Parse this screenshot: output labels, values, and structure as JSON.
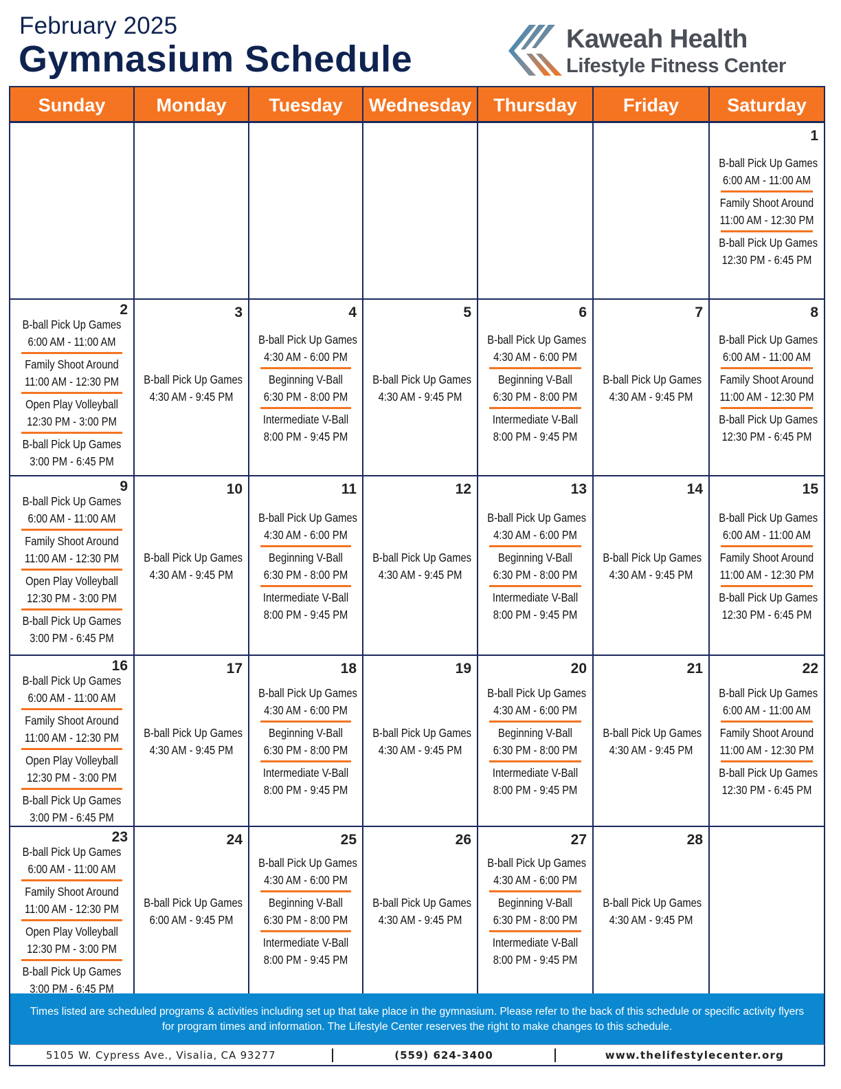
{
  "header": {
    "month": "February 2025",
    "title": "Gymnasium Schedule"
  },
  "logo": {
    "icon": "kaweah-health-k-logo-icon",
    "line1": "Kaweah Health",
    "line2": "Lifestyle Fitness Center",
    "colors": {
      "blue": "#1e88c9",
      "gray": "#6d6f73",
      "orange": "#f47421",
      "text": "#4a4f57"
    }
  },
  "colors": {
    "accent": "#f47421",
    "navy": "#1b2a5c",
    "notice_bg": "#0b88cf",
    "title": "#0f2350"
  },
  "days_of_week": [
    "Sunday",
    "Monday",
    "Tuesday",
    "Wednesday",
    "Thursday",
    "Friday",
    "Saturday"
  ],
  "weeks": [
    [
      {
        "day": "",
        "events": []
      },
      {
        "day": "",
        "events": []
      },
      {
        "day": "",
        "events": []
      },
      {
        "day": "",
        "events": []
      },
      {
        "day": "",
        "events": []
      },
      {
        "day": "",
        "events": []
      },
      {
        "day": "1",
        "events": [
          {
            "name": "B-ball Pick Up Games",
            "time": "6:00 AM - 11:00 AM"
          },
          {
            "name": "Family Shoot Around",
            "time": "11:00 AM - 12:30 PM"
          },
          {
            "name": "B-ball Pick Up Games",
            "time": "12:30 PM - 6:45 PM"
          }
        ]
      }
    ],
    [
      {
        "day": "2",
        "events": [
          {
            "name": "B-ball Pick Up Games",
            "time": "6:00 AM - 11:00 AM"
          },
          {
            "name": "Family Shoot Around",
            "time": "11:00 AM - 12:30 PM"
          },
          {
            "name": "Open Play Volleyball",
            "time": "12:30 PM - 3:00 PM"
          },
          {
            "name": "B-ball Pick Up Games",
            "time": "3:00 PM - 6:45 PM"
          }
        ]
      },
      {
        "day": "3",
        "events": [
          {
            "name": "B-ball Pick Up Games",
            "time": "4:30 AM - 9:45 PM"
          }
        ]
      },
      {
        "day": "4",
        "events": [
          {
            "name": "B-ball Pick Up Games",
            "time": "4:30 AM - 6:00 PM"
          },
          {
            "name": "Beginning V-Ball",
            "time": "6:30 PM - 8:00 PM"
          },
          {
            "name": "Intermediate V-Ball",
            "time": "8:00 PM - 9:45 PM"
          }
        ]
      },
      {
        "day": "5",
        "events": [
          {
            "name": "B-ball Pick Up Games",
            "time": "4:30 AM - 9:45 PM"
          }
        ]
      },
      {
        "day": "6",
        "events": [
          {
            "name": "B-ball Pick Up Games",
            "time": "4:30 AM - 6:00 PM"
          },
          {
            "name": "Beginning V-Ball",
            "time": "6:30 PM - 8:00 PM"
          },
          {
            "name": "Intermediate V-Ball",
            "time": "8:00 PM - 9:45 PM"
          }
        ]
      },
      {
        "day": "7",
        "events": [
          {
            "name": "B-ball Pick Up Games",
            "time": "4:30 AM - 9:45 PM"
          }
        ]
      },
      {
        "day": "8",
        "events": [
          {
            "name": "B-ball Pick Up Games",
            "time": "6:00 AM - 11:00 AM"
          },
          {
            "name": "Family Shoot Around",
            "time": "11:00 AM - 12:30 PM"
          },
          {
            "name": "B-ball Pick Up Games",
            "time": "12:30 PM - 6:45 PM"
          }
        ]
      }
    ],
    [
      {
        "day": "9",
        "events": [
          {
            "name": "B-ball Pick Up Games",
            "time": "6:00 AM - 11:00 AM"
          },
          {
            "name": "Family Shoot Around",
            "time": "11:00 AM - 12:30 PM"
          },
          {
            "name": "Open Play Volleyball",
            "time": "12:30 PM - 3:00 PM"
          },
          {
            "name": "B-ball Pick Up Games",
            "time": "3:00 PM - 6:45 PM"
          }
        ]
      },
      {
        "day": "10",
        "events": [
          {
            "name": "B-ball Pick Up Games",
            "time": "4:30 AM - 9:45 PM"
          }
        ]
      },
      {
        "day": "11",
        "events": [
          {
            "name": "B-ball Pick Up Games",
            "time": "4:30 AM - 6:00 PM"
          },
          {
            "name": "Beginning V-Ball",
            "time": "6:30 PM - 8:00 PM"
          },
          {
            "name": "Intermediate V-Ball",
            "time": "8:00 PM - 9:45 PM"
          }
        ]
      },
      {
        "day": "12",
        "events": [
          {
            "name": "B-ball Pick Up Games",
            "time": "4:30 AM - 9:45 PM"
          }
        ]
      },
      {
        "day": "13",
        "events": [
          {
            "name": "B-ball Pick Up Games",
            "time": "4:30 AM - 6:00 PM"
          },
          {
            "name": "Beginning V-Ball",
            "time": "6:30 PM - 8:00 PM"
          },
          {
            "name": "Intermediate V-Ball",
            "time": "8:00 PM - 9:45 PM"
          }
        ]
      },
      {
        "day": "14",
        "events": [
          {
            "name": "B-ball Pick Up Games",
            "time": "4:30 AM - 9:45 PM"
          }
        ]
      },
      {
        "day": "15",
        "events": [
          {
            "name": "B-ball Pick Up Games",
            "time": "6:00 AM - 11:00 AM"
          },
          {
            "name": "Family Shoot Around",
            "time": "11:00 AM - 12:30 PM"
          },
          {
            "name": "B-ball Pick Up Games",
            "time": "12:30 PM - 6:45 PM"
          }
        ]
      }
    ],
    [
      {
        "day": "16",
        "events": [
          {
            "name": "B-ball Pick Up Games",
            "time": "6:00 AM - 11:00 AM"
          },
          {
            "name": "Family Shoot Around",
            "time": "11:00 AM - 12:30 PM"
          },
          {
            "name": "Open Play Volleyball",
            "time": "12:30 PM - 3:00 PM"
          },
          {
            "name": "B-ball Pick Up Games",
            "time": "3:00 PM - 6:45 PM"
          }
        ]
      },
      {
        "day": "17",
        "events": [
          {
            "name": "B-ball Pick Up Games",
            "time": "4:30 AM - 9:45 PM"
          }
        ]
      },
      {
        "day": "18",
        "events": [
          {
            "name": "B-ball Pick Up Games",
            "time": "4:30 AM - 6:00 PM"
          },
          {
            "name": "Beginning V-Ball",
            "time": "6:30 PM - 8:00 PM"
          },
          {
            "name": "Intermediate V-Ball",
            "time": "8:00 PM - 9:45 PM"
          }
        ]
      },
      {
        "day": "19",
        "events": [
          {
            "name": "B-ball Pick Up Games",
            "time": "4:30 AM - 9:45 PM"
          }
        ]
      },
      {
        "day": "20",
        "events": [
          {
            "name": "B-ball Pick Up Games",
            "time": "4:30 AM - 6:00 PM"
          },
          {
            "name": "Beginning V-Ball",
            "time": "6:30 PM - 8:00 PM"
          },
          {
            "name": "Intermediate V-Ball",
            "time": "8:00 PM - 9:45 PM"
          }
        ]
      },
      {
        "day": "21",
        "events": [
          {
            "name": "B-ball Pick Up Games",
            "time": "4:30 AM - 9:45 PM"
          }
        ]
      },
      {
        "day": "22",
        "events": [
          {
            "name": "B-ball Pick Up Games",
            "time": "6:00 AM - 11:00 AM"
          },
          {
            "name": "Family Shoot Around",
            "time": "11:00 AM - 12:30 PM"
          },
          {
            "name": "B-ball Pick Up Games",
            "time": "12:30 PM - 6:45 PM"
          }
        ]
      }
    ],
    [
      {
        "day": "23",
        "events": [
          {
            "name": "B-ball Pick Up Games",
            "time": "6:00 AM - 11:00 AM"
          },
          {
            "name": "Family Shoot Around",
            "time": "11:00 AM - 12:30 PM"
          },
          {
            "name": "Open Play Volleyball",
            "time": "12:30 PM - 3:00 PM"
          },
          {
            "name": "B-ball Pick Up Games",
            "time": "3:00 PM - 6:45 PM"
          }
        ]
      },
      {
        "day": "24",
        "events": [
          {
            "name": "B-ball Pick Up Games",
            "time": "6:00 AM - 9:45 PM"
          }
        ]
      },
      {
        "day": "25",
        "events": [
          {
            "name": "B-ball Pick Up Games",
            "time": "4:30 AM - 6:00 PM"
          },
          {
            "name": "Beginning V-Ball",
            "time": "6:30 PM - 8:00 PM"
          },
          {
            "name": "Intermediate V-Ball",
            "time": "8:00 PM - 9:45 PM"
          }
        ]
      },
      {
        "day": "26",
        "events": [
          {
            "name": "B-ball Pick Up Games",
            "time": "4:30 AM - 9:45 PM"
          }
        ]
      },
      {
        "day": "27",
        "events": [
          {
            "name": "B-ball Pick Up Games",
            "time": "4:30 AM - 6:00 PM"
          },
          {
            "name": "Beginning V-Ball",
            "time": "6:30 PM - 8:00 PM"
          },
          {
            "name": "Intermediate V-Ball",
            "time": "8:00 PM - 9:45 PM"
          }
        ]
      },
      {
        "day": "28",
        "events": [
          {
            "name": "B-ball Pick Up Games",
            "time": "4:30 AM - 9:45 PM"
          }
        ]
      },
      {
        "day": "",
        "events": []
      }
    ]
  ],
  "notice": "Times listed are scheduled programs & activities including set up that take place in the gymnasium. Please refer to the back of this schedule or specific activity flyers for program times and information.  The Lifestyle Center reserves the right to make changes to this schedule.",
  "contact": {
    "address": "5105 W. Cypress Ave.,  Visalia, CA 93277",
    "phone": "(559) 624-3400",
    "website": "www.thelifestylecenter.org"
  }
}
